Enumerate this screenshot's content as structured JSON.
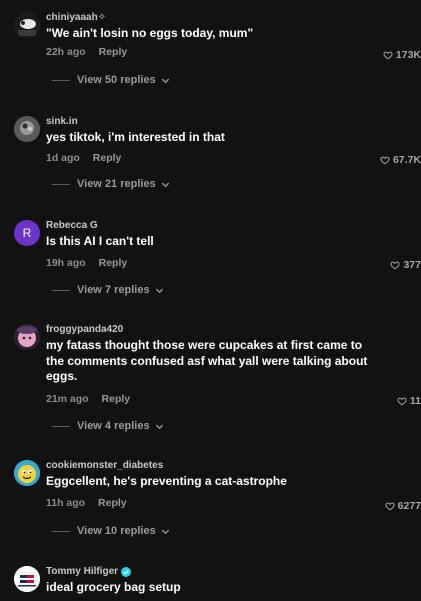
{
  "comments": [
    {
      "username": "chiniyaaah✧",
      "text": "\"We ain't losin no eggs today, mum\"",
      "time": "22h ago",
      "reply": "Reply",
      "likes": "173K",
      "view_replies": "View 50 replies",
      "avatar": "dark-photo-avatar"
    },
    {
      "username": "sink.in",
      "text": "yes tiktok, i'm interested in that",
      "time": "1d ago",
      "reply": "Reply",
      "likes": "67.7K",
      "view_replies": "View 21 replies",
      "avatar": "gray-photo-avatar"
    },
    {
      "username": "Rebecca G",
      "text": "Is this AI I can't tell",
      "time": "19h ago",
      "reply": "Reply",
      "likes": "377",
      "view_replies": "View 7 replies",
      "avatar_letter": "R",
      "avatar_color": "#6c35c9"
    },
    {
      "username": "froggypanda420",
      "text": "my fatass thought those were cupcakes at first came to the comments confused asf what yall were talking about eggs.",
      "time": "21m ago",
      "reply": "Reply",
      "likes": "11",
      "view_replies": "View 4 replies",
      "avatar": "pink-cartoon-avatar"
    },
    {
      "username": "cookiemonster_diabetes",
      "text": "Eggcellent, he's preventing a cat-astrophe",
      "time": "11h ago",
      "reply": "Reply",
      "likes": "6277",
      "view_replies": "View 10 replies",
      "avatar": "yellow-cartoon-avatar"
    },
    {
      "username": "Tommy Hilfiger",
      "text": "ideal grocery bag setup",
      "verified": true,
      "avatar": "brand-logo-avatar"
    }
  ],
  "colors": {
    "background": "#121212",
    "verified": "#20d5ec"
  }
}
